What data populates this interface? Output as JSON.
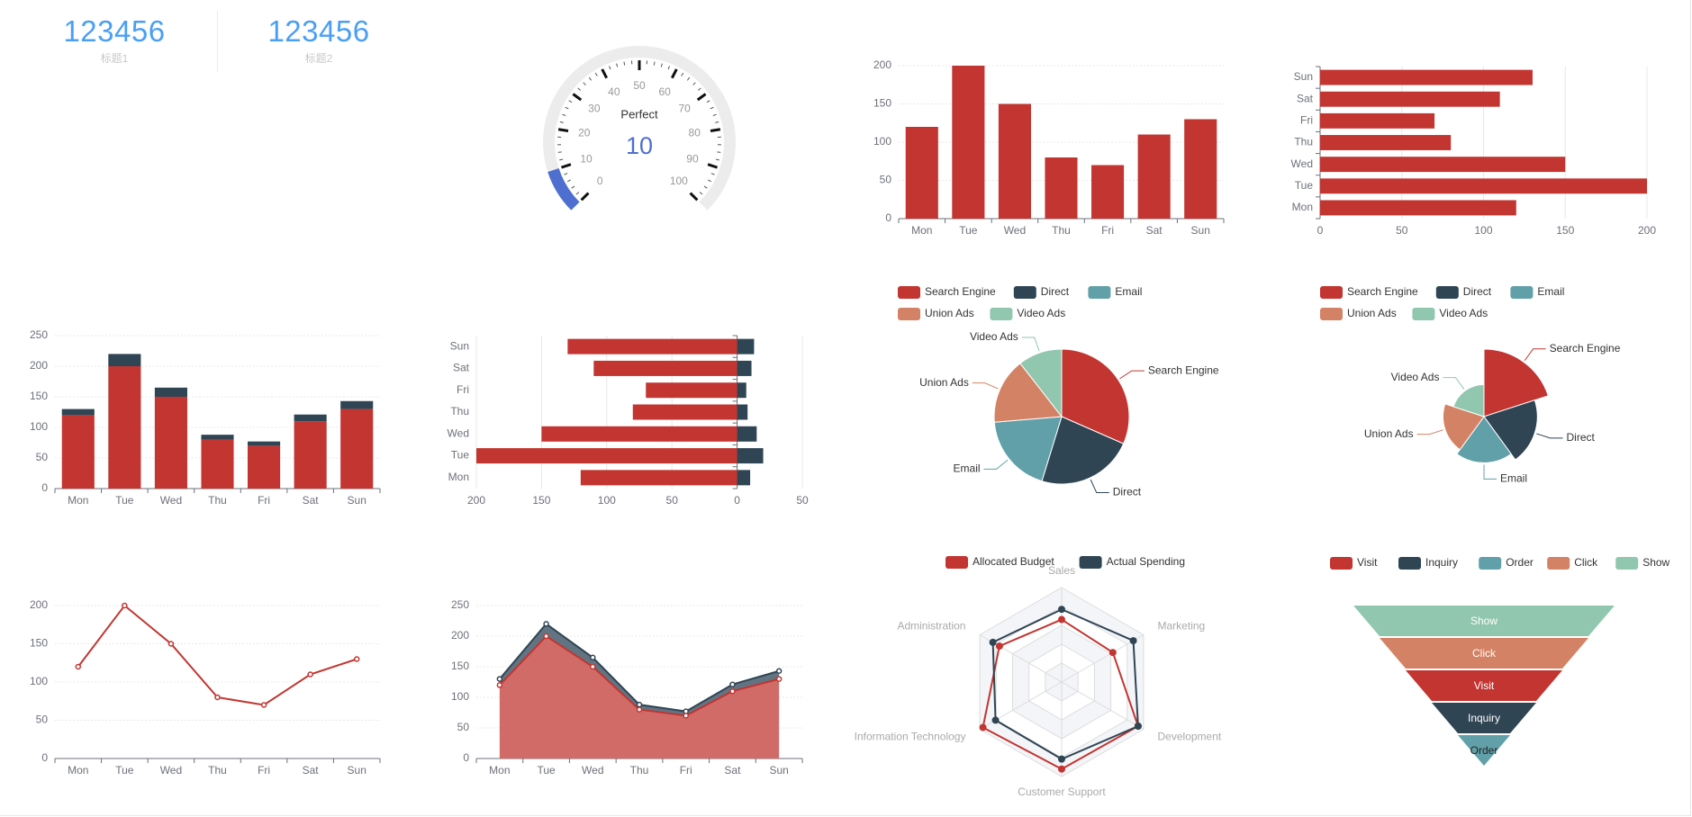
{
  "stats": [
    {
      "value": "123456",
      "label": "标题1"
    },
    {
      "value": "123456",
      "label": "标题2"
    }
  ],
  "colors": {
    "red": "#c23531",
    "navy": "#2f4554",
    "teal": "#61a0a8",
    "orange": "#d48265",
    "mint": "#91c7ae",
    "gauge_blue": "#4f6fd0",
    "stat_blue": "#4a9ff5"
  },
  "chart_data": [
    {
      "id": "gauge",
      "type": "gauge",
      "title": "Perfect",
      "value": 10,
      "min": 0,
      "max": 100,
      "tick_labels": [
        "0",
        "10",
        "20",
        "30",
        "40",
        "50",
        "60",
        "70",
        "80",
        "90",
        "100"
      ]
    },
    {
      "id": "bar1",
      "type": "bar",
      "categories": [
        "Mon",
        "Tue",
        "Wed",
        "Thu",
        "Fri",
        "Sat",
        "Sun"
      ],
      "values": [
        120,
        200,
        150,
        80,
        70,
        110,
        130
      ],
      "ylim": [
        0,
        200
      ],
      "yticks": [
        0,
        50,
        100,
        150,
        200
      ],
      "grid": true
    },
    {
      "id": "hbar1",
      "type": "bar",
      "orientation": "horizontal",
      "categories": [
        "Mon",
        "Tue",
        "Wed",
        "Thu",
        "Fri",
        "Sat",
        "Sun"
      ],
      "values": [
        120,
        200,
        150,
        80,
        70,
        110,
        130
      ],
      "xlim": [
        0,
        200
      ],
      "xticks": [
        0,
        50,
        100,
        150,
        200
      ],
      "grid": true
    },
    {
      "id": "stacked",
      "type": "bar",
      "stacked": true,
      "categories": [
        "Mon",
        "Tue",
        "Wed",
        "Thu",
        "Fri",
        "Sat",
        "Sun"
      ],
      "series": [
        {
          "values": [
            120,
            200,
            150,
            80,
            70,
            110,
            130
          ]
        },
        {
          "values": [
            10,
            20,
            15,
            8,
            7,
            11,
            13
          ]
        }
      ],
      "ylim": [
        0,
        250
      ],
      "yticks": [
        0,
        50,
        100,
        150,
        200,
        250
      ],
      "grid": true
    },
    {
      "id": "hbar2",
      "type": "bar",
      "orientation": "horizontal",
      "diverging": true,
      "categories": [
        "Mon",
        "Tue",
        "Wed",
        "Thu",
        "Fri",
        "Sat",
        "Sun"
      ],
      "series": [
        {
          "values": [
            120,
            200,
            150,
            80,
            70,
            110,
            130
          ],
          "side": "left"
        },
        {
          "values": [
            10,
            20,
            15,
            8,
            7,
            11,
            13
          ],
          "side": "right"
        }
      ],
      "xlim": [
        -200,
        50
      ],
      "tick_values": [
        -200,
        -150,
        -100,
        -50,
        0,
        50
      ],
      "tick_labels": [
        "200",
        "150",
        "100",
        "50",
        "0",
        "50"
      ],
      "grid": true
    },
    {
      "id": "pie1",
      "type": "pie",
      "legend": "top",
      "slices": [
        {
          "name": "Search Engine",
          "value": 30
        },
        {
          "name": "Direct",
          "value": 22
        },
        {
          "name": "Email",
          "value": 18
        },
        {
          "name": "Union Ads",
          "value": 15
        },
        {
          "name": "Video Ads",
          "value": 10
        }
      ]
    },
    {
      "id": "rose",
      "type": "pie",
      "variant": "rose",
      "legend": "top",
      "slices": [
        {
          "name": "Search Engine",
          "value": 30
        },
        {
          "name": "Direct",
          "value": 22
        },
        {
          "name": "Email",
          "value": 18
        },
        {
          "name": "Union Ads",
          "value": 15
        },
        {
          "name": "Video Ads",
          "value": 10
        }
      ]
    },
    {
      "id": "line1",
      "type": "line",
      "categories": [
        "Mon",
        "Tue",
        "Wed",
        "Thu",
        "Fri",
        "Sat",
        "Sun"
      ],
      "values": [
        120,
        200,
        150,
        80,
        70,
        110,
        130
      ],
      "ylim": [
        0,
        200
      ],
      "yticks": [
        0,
        50,
        100,
        150,
        200
      ],
      "grid": true
    },
    {
      "id": "area",
      "type": "area",
      "stacked": true,
      "categories": [
        "Mon",
        "Tue",
        "Wed",
        "Thu",
        "Fri",
        "Sat",
        "Sun"
      ],
      "series": [
        {
          "values": [
            120,
            200,
            150,
            80,
            70,
            110,
            130
          ]
        },
        {
          "values": [
            10,
            20,
            15,
            8,
            7,
            11,
            13
          ]
        }
      ],
      "ylim": [
        0,
        250
      ],
      "yticks": [
        0,
        50,
        100,
        150,
        200,
        250
      ],
      "grid": true
    },
    {
      "id": "radar",
      "type": "radar",
      "legend": "top",
      "indicators": [
        {
          "name": "Sales",
          "max": 6500
        },
        {
          "name": "Marketing",
          "max": 16000
        },
        {
          "name": "Development",
          "max": 30000
        },
        {
          "name": "Customer Support",
          "max": 38000
        },
        {
          "name": "Information Technology",
          "max": 52000
        },
        {
          "name": "Administration",
          "max": 25000
        }
      ],
      "series": [
        {
          "name": "Allocated Budget",
          "values": [
            4300,
            10000,
            28000,
            35000,
            50000,
            19000
          ]
        },
        {
          "name": "Actual Spending",
          "values": [
            5000,
            14000,
            28000,
            31000,
            42000,
            21000
          ]
        }
      ]
    },
    {
      "id": "funnel",
      "type": "funnel",
      "legend": "top",
      "items": [
        {
          "name": "Show",
          "value": 100
        },
        {
          "name": "Click",
          "value": 80
        },
        {
          "name": "Visit",
          "value": 60
        },
        {
          "name": "Inquiry",
          "value": 40
        },
        {
          "name": "Order",
          "value": 20
        }
      ],
      "legend_order": [
        "Visit",
        "Inquiry",
        "Order",
        "Click",
        "Show"
      ]
    }
  ]
}
